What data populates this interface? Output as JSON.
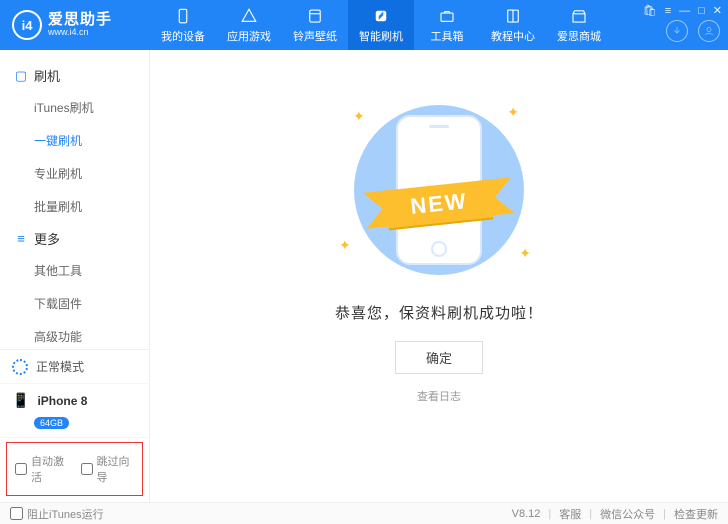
{
  "app": {
    "name_cn": "爱思助手",
    "name_en": "www.i4.cn",
    "logo_text": "i4"
  },
  "win": {
    "shop": "🛍",
    "menu": "≡",
    "min": "—",
    "max": "□",
    "close": "✕"
  },
  "topnav": [
    {
      "label": "我的设备",
      "icon": "device"
    },
    {
      "label": "应用游戏",
      "icon": "apps"
    },
    {
      "label": "铃声壁纸",
      "icon": "music"
    },
    {
      "label": "智能刷机",
      "icon": "flash",
      "active": true
    },
    {
      "label": "工具箱",
      "icon": "toolbox"
    },
    {
      "label": "教程中心",
      "icon": "book"
    },
    {
      "label": "爱思商城",
      "icon": "store"
    }
  ],
  "sidebar": {
    "group1": {
      "title": "刷机",
      "items": [
        "iTunes刷机",
        "一键刷机",
        "专业刷机",
        "批量刷机"
      ],
      "active_index": 1
    },
    "group2": {
      "title": "更多",
      "items": [
        "其他工具",
        "下载固件",
        "高级功能"
      ]
    }
  },
  "mode": {
    "label": "正常模式"
  },
  "device": {
    "name": "iPhone 8",
    "storage": "64GB"
  },
  "options": {
    "auto_activate": "自动激活",
    "skip_guide": "跳过向导"
  },
  "main": {
    "ribbon": "NEW",
    "message": "恭喜您，保资料刷机成功啦！",
    "ok": "确定",
    "log": "查看日志"
  },
  "status": {
    "block_itunes": "阻止iTunes运行",
    "version": "V8.12",
    "support": "客服",
    "wechat": "微信公众号",
    "update": "检查更新"
  }
}
